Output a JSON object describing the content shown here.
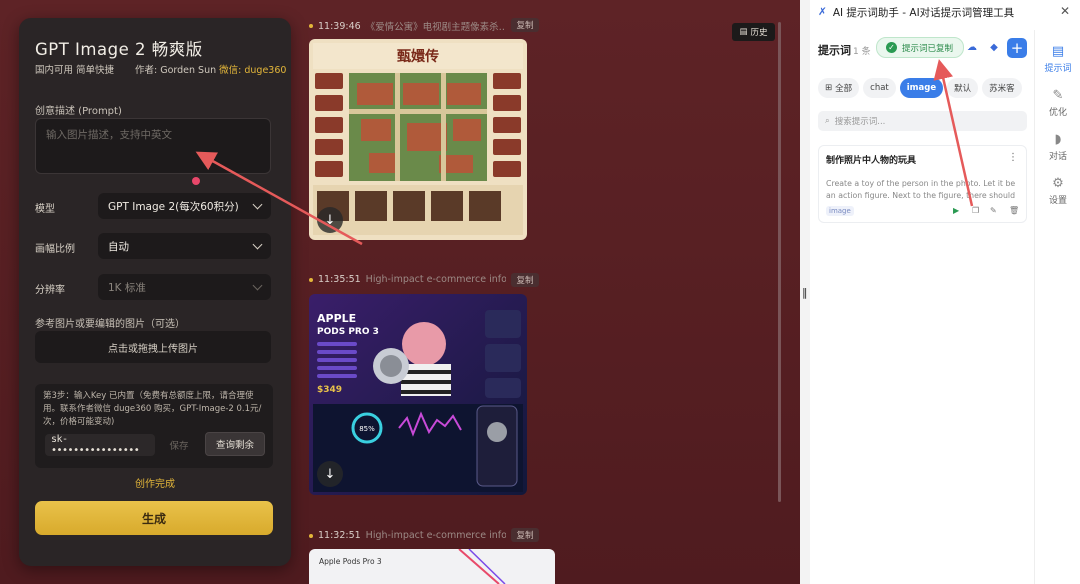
{
  "left_panel": {
    "title": "GPT Image 2 畅爽版",
    "subtitle": "国内可用 简单快捷",
    "author_prefix": "作者: Gorden Sun ",
    "author_wechat": "微信: duge360",
    "prompt_label": "创意描述 (Prompt)",
    "prompt_placeholder": "输入图片描述，支持中英文",
    "model_label": "模型",
    "model_value": "GPT Image 2(每次60积分)",
    "ratio_label": "画幅比例",
    "ratio_value": "自动",
    "resolution_label": "分辨率",
    "resolution_value": "1K 标准",
    "ref_label": "参考图片或要编辑的图片（可选）",
    "upload_text": "点击或拖拽上传图片",
    "key_note": "第3步：输入Key 已内置（免费有总额度上限，请合理使用。联系作者微信 duge360 购买，GPT-Image-2 0.1元/次，价格可能变动)",
    "key_value": "sk-••••••••••••••••",
    "save_label": "保存",
    "query_label": "查询剩余",
    "status_text": "创作完成",
    "generate_label": "生成"
  },
  "history": {
    "button_label": "历史",
    "items": [
      {
        "time": "11:39:46",
        "desc": "《爱情公寓》电视剧主题像素杀…",
        "copy": "复制"
      },
      {
        "time": "11:35:51",
        "desc": "High-impact e-commerce infogr…",
        "copy": "复制"
      },
      {
        "time": "11:32:51",
        "desc": "High-impact e-commerce infogr…",
        "copy": "复制"
      }
    ],
    "image1": {
      "title": "甄嬛传"
    },
    "image2": {
      "brand": "APPLE",
      "product": "PODS PRO 3",
      "price": "$349",
      "stat": "85%"
    },
    "image3": {
      "label": "Apple Pods Pro 3"
    }
  },
  "app": {
    "title": "AI 提示词助手 - AI对话提示词管理工具",
    "section_title": "提示词",
    "count": "1 条",
    "toast": "提示词已复制",
    "tabs": [
      "全部",
      "chat",
      "image",
      "默认",
      "苏米客"
    ],
    "active_tab": "image",
    "search_placeholder": "搜索提示词...",
    "card": {
      "title": "制作照片中人物的玩具",
      "desc": "Create a toy of the person in the photo. Let it be an action figure. Next to the figure, there should be...",
      "tag": "image"
    },
    "side_nav": [
      "提示词",
      "优化",
      "对话",
      "设置"
    ]
  },
  "colors": {
    "accent_gold": "#e3b63a",
    "app_blue": "#3a7de8",
    "arrow_red": "#e55a5a"
  }
}
